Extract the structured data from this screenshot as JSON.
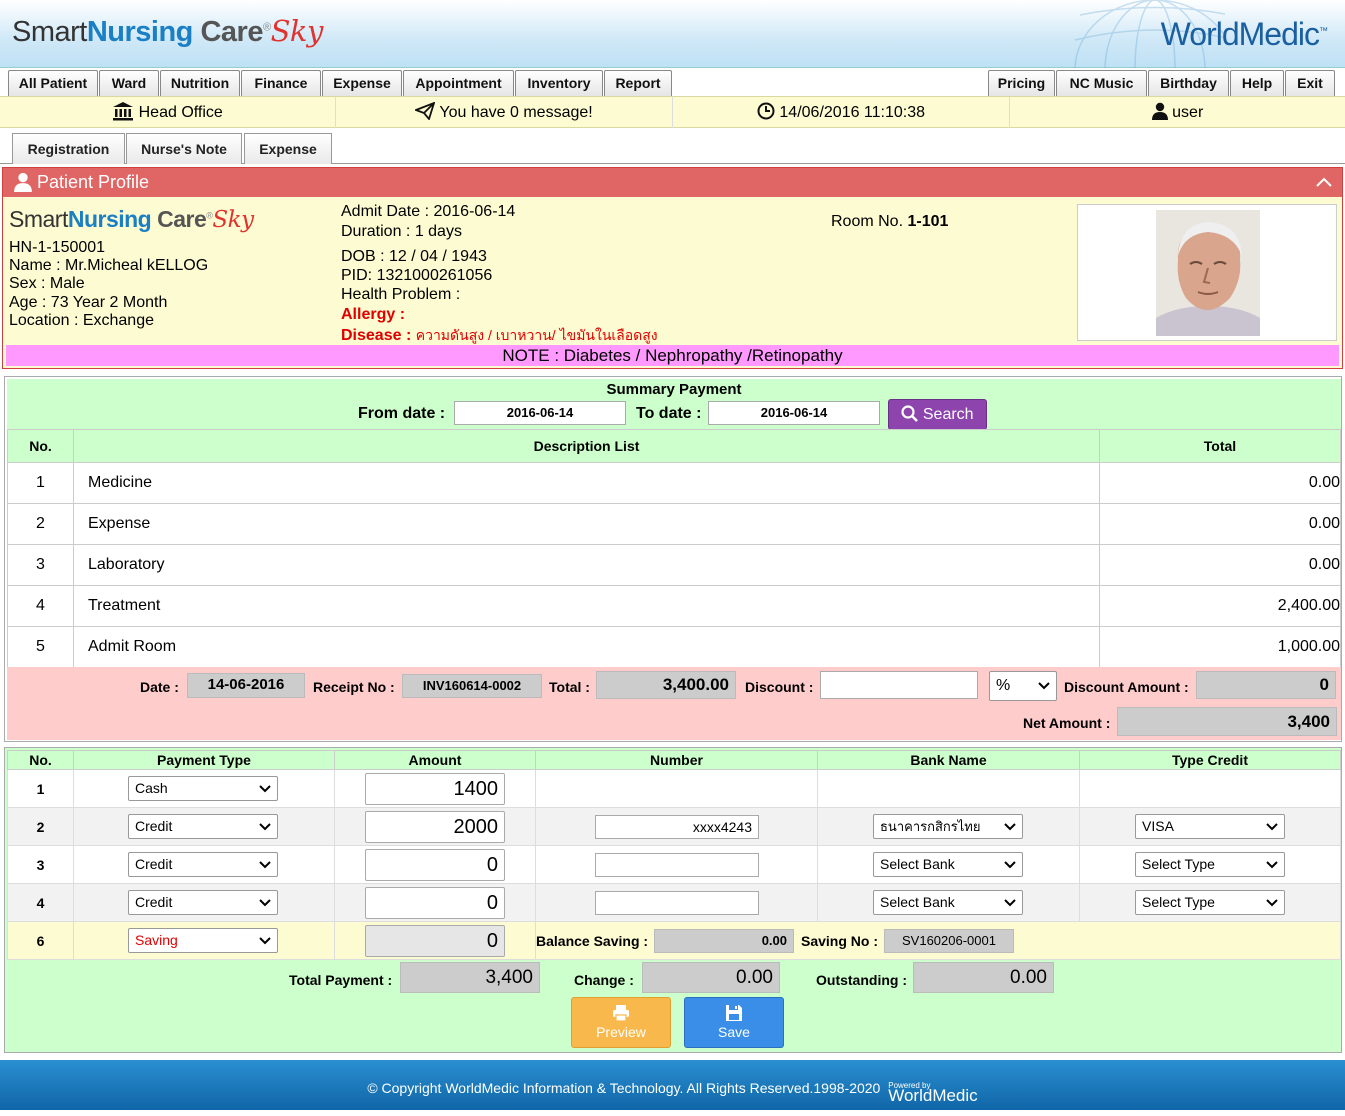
{
  "header": {
    "logo_smart": "Smart",
    "logo_nursing": "Nursing",
    "logo_care": " Care",
    "logo_reg": "®",
    "logo_sky": "Sky",
    "brand": "WorldMedic",
    "brand_tm": "™"
  },
  "menu": {
    "left": [
      "All Patient",
      "Ward",
      "Nutrition",
      "Finance",
      "Expense",
      "Appointment",
      "Inventory",
      "Report"
    ],
    "right": [
      "Pricing",
      "NC Music",
      "Birthday",
      "Help",
      "Exit"
    ]
  },
  "infobar": {
    "office": "Head Office",
    "message": "You have 0 message!",
    "datetime": "14/06/2016 11:10:38",
    "user": "user"
  },
  "subtabs": [
    "Registration",
    "Nurse's Note",
    "Expense"
  ],
  "profile": {
    "title": "Patient Profile",
    "hn": "HN-1-150001",
    "name": "Name : Mr.Micheal kELLOG",
    "sex": "Sex : Male",
    "age": "Age : 73 Year 2 Month",
    "location": "Location : Exchange",
    "admit_date": "Admit Date : 2016-06-14",
    "duration": "Duration : 1 days",
    "dob": "DOB : 12 / 04 / 1943",
    "pid": "PID: 1321000261056",
    "health_problem": "Health Problem :",
    "allergy_label": "Allergy :",
    "disease_label": "Disease :",
    "disease_value": "ความดันสูง / เบาหวาน/ ไขมันในเลือดสูง",
    "room_label": "Room No.",
    "room_value": "1-101",
    "note": "NOTE : Diabetes / Nephropathy /Retinopathy"
  },
  "summary": {
    "title": "Summary Payment",
    "from_label": "From date :",
    "from_value": "2016-06-14",
    "to_label": "To date :",
    "to_value": "2016-06-14",
    "search_label": "Search",
    "columns": [
      "No.",
      "Description List",
      "Total"
    ],
    "rows": [
      {
        "no": "1",
        "desc": "Medicine",
        "total": "0.00"
      },
      {
        "no": "2",
        "desc": "Expense",
        "total": "0.00"
      },
      {
        "no": "3",
        "desc": "Laboratory",
        "total": "0.00"
      },
      {
        "no": "4",
        "desc": "Treatment",
        "total": "2,400.00"
      },
      {
        "no": "5",
        "desc": "Admit Room",
        "total": "1,000.00"
      }
    ],
    "date_label": "Date :",
    "date_value": "14-06-2016",
    "receipt_label": "Receipt No :",
    "receipt_value": "INV160614-0002",
    "total_label": "Total :",
    "total_value": "3,400.00",
    "discount_label": "Discount :",
    "discount_value": "",
    "discount_unit": "%",
    "discount_amount_label": "Discount Amount :",
    "discount_amount_value": "0",
    "net_label": "Net Amount :",
    "net_value": "3,400"
  },
  "payment": {
    "columns": [
      "No.",
      "Payment Type",
      "Amount",
      "Number",
      "Bank Name",
      "Type Credit"
    ],
    "rows": [
      {
        "no": "1",
        "type": "Cash",
        "amount": "1400",
        "number": "",
        "bank": "",
        "credit": ""
      },
      {
        "no": "2",
        "type": "Credit",
        "amount": "2000",
        "number": "xxxx4243",
        "bank": "ธนาคารกสิกรไทย",
        "credit": "VISA"
      },
      {
        "no": "3",
        "type": "Credit",
        "amount": "0",
        "number": "",
        "bank": "Select Bank",
        "credit": "Select Type"
      },
      {
        "no": "4",
        "type": "Credit",
        "amount": "0",
        "number": "",
        "bank": "Select Bank",
        "credit": "Select Type"
      }
    ],
    "saving_row": {
      "no": "6",
      "type": "Saving",
      "amount": "0"
    },
    "balance_label": "Balance Saving :",
    "balance_value": "0.00",
    "saving_no_label": "Saving No :",
    "saving_no_value": "SV160206-0001",
    "total_payment_label": "Total Payment :",
    "total_payment_value": "3,400",
    "change_label": "Change :",
    "change_value": "0.00",
    "outstanding_label": "Outstanding :",
    "outstanding_value": "0.00",
    "preview_label": "Preview",
    "save_label": "Save"
  },
  "footer": {
    "copyright": "© Copyright WorldMedic Information & Technology. All Rights Reserved.1998-2020",
    "powered": "Powered by",
    "brand": "WorldMedic"
  },
  "colors": {
    "header_red": "#e06666",
    "green_bg": "#ccffcc",
    "pink_bg": "#ffcccc",
    "note_bg": "#ff99ff",
    "search_purple": "#8e44ad",
    "preview_orange": "#f9b84b",
    "save_blue": "#3b8ee8"
  }
}
